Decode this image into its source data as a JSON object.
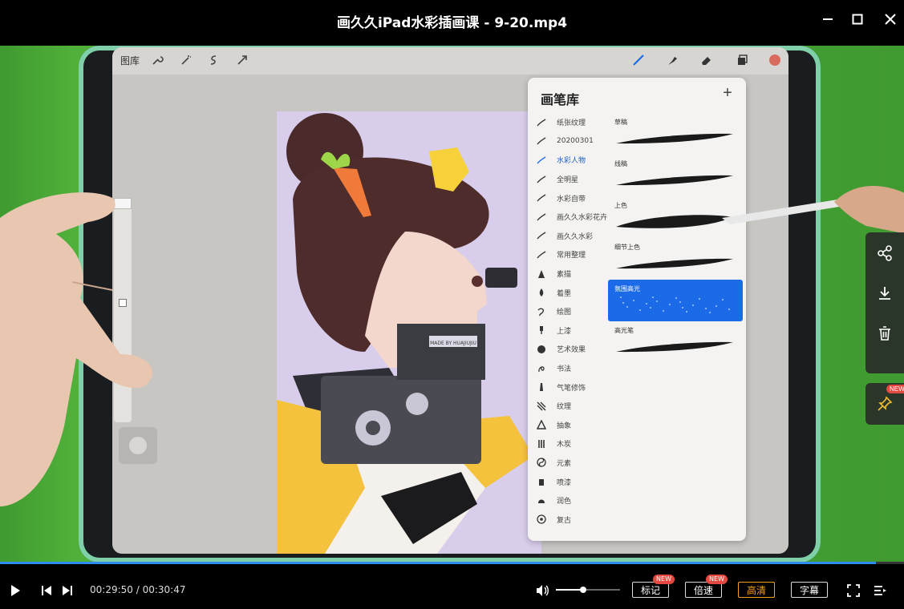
{
  "window": {
    "title": "画久久iPad水彩插画课 - 9-20.mp4"
  },
  "procreate": {
    "gallery_label": "图库",
    "brush_library": {
      "title": "画笔库",
      "add_icon": "plus-icon",
      "categories": [
        {
          "label": "纸张纹理"
        },
        {
          "label": "20200301"
        },
        {
          "label": "水彩人物",
          "selected": true
        },
        {
          "label": "全明星"
        },
        {
          "label": "水彩自带"
        },
        {
          "label": "画久久水彩花卉"
        },
        {
          "label": "画久久水彩"
        },
        {
          "label": "常用整理"
        },
        {
          "label": "素描"
        },
        {
          "label": "着墨"
        },
        {
          "label": "绘图"
        },
        {
          "label": "上漆"
        },
        {
          "label": "艺术效果"
        },
        {
          "label": "书法"
        },
        {
          "label": "气笔修饰"
        },
        {
          "label": "纹理"
        },
        {
          "label": "抽象"
        },
        {
          "label": "木炭"
        },
        {
          "label": "元素"
        },
        {
          "label": "喷漆"
        },
        {
          "label": "润色"
        },
        {
          "label": "复古"
        }
      ],
      "brushes": [
        {
          "label": "草稿"
        },
        {
          "label": "线稿"
        },
        {
          "label": "上色"
        },
        {
          "label": "细节上色"
        },
        {
          "label": "氛围高光",
          "selected": true
        },
        {
          "label": "高光笔"
        }
      ]
    },
    "canvas_sign": "MADE BY HUAJIUJIU"
  },
  "player": {
    "current_time": "00:29:50",
    "duration": "00:30:47",
    "time_separator": " / ",
    "progress_fraction": 0.969,
    "volume_fraction": 0.42,
    "buttons": {
      "mark": "标记",
      "speed": "倍速",
      "quality": "高清",
      "subtitle": "字幕",
      "new_badge": "NEW"
    }
  },
  "colors": {
    "accent": "#2d8cf0",
    "quality_active": "#f0a020",
    "badge": "#e5483e",
    "selected_brush": "#1b6be8"
  }
}
